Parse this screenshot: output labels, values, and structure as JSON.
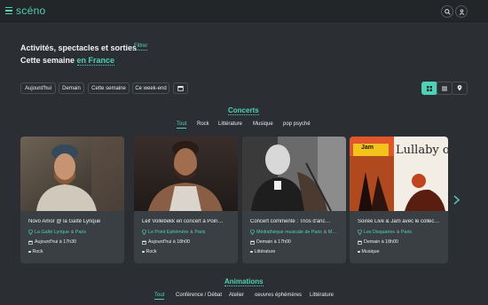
{
  "app": {
    "name": "scéno"
  },
  "hero": {
    "line1": "Activités, spectacles et sorties",
    "filter_label": "Filtrer",
    "line2_prefix": "Cette semaine",
    "location": "en France"
  },
  "date_filters": [
    "Aujourd'hui",
    "Demain",
    "Cette semaine",
    "Ce week-end"
  ],
  "sections": {
    "concerts": {
      "title": "Concerts",
      "tabs": [
        "Tout",
        "Rock",
        "Littérature",
        "Musique",
        "pop psyché"
      ],
      "cards": [
        {
          "title": "Novo Amor @ la Gaîté Lyrique",
          "venue": "La Gaîté Lyrique",
          "city": "Paris",
          "date": "Aujourd'hui à 17h30",
          "genre": "Rock"
        },
        {
          "title": "Leif Vollebekk en concert à Poin…",
          "venue": "Le Point Ephémère",
          "city": "Paris",
          "date": "Aujourd'hui à 18h00",
          "genre": "Rock"
        },
        {
          "title": "Concert commenté : Trios d'anc…",
          "venue": "Médiathèque musicale de Paris",
          "city": "M…",
          "date": "Demain à 17h00",
          "genre": "Littérature"
        },
        {
          "title": "Soirée Live & Jam avec le collec…",
          "venue": "Les Disquaires",
          "city": "Paris",
          "date": "Demain à 18h00",
          "genre": "Musique"
        }
      ]
    },
    "animations": {
      "title": "Animations",
      "tabs": [
        "Tout",
        "Conférence / Débat",
        "Atelier",
        "oeuvres éphémères",
        "Littérature"
      ]
    }
  },
  "card4_overlay": {
    "jam": "Jam",
    "lullaby": "Lullaby of D"
  },
  "colors": {
    "accent": "#4fd1b5",
    "background": "#2b2f33",
    "card": "#3a3f44"
  },
  "icons": [
    "menu-icon",
    "search-icon",
    "user-icon",
    "grid-icon",
    "list-icon",
    "map-pin-icon",
    "calendar-icon",
    "chevron-right-icon"
  ]
}
